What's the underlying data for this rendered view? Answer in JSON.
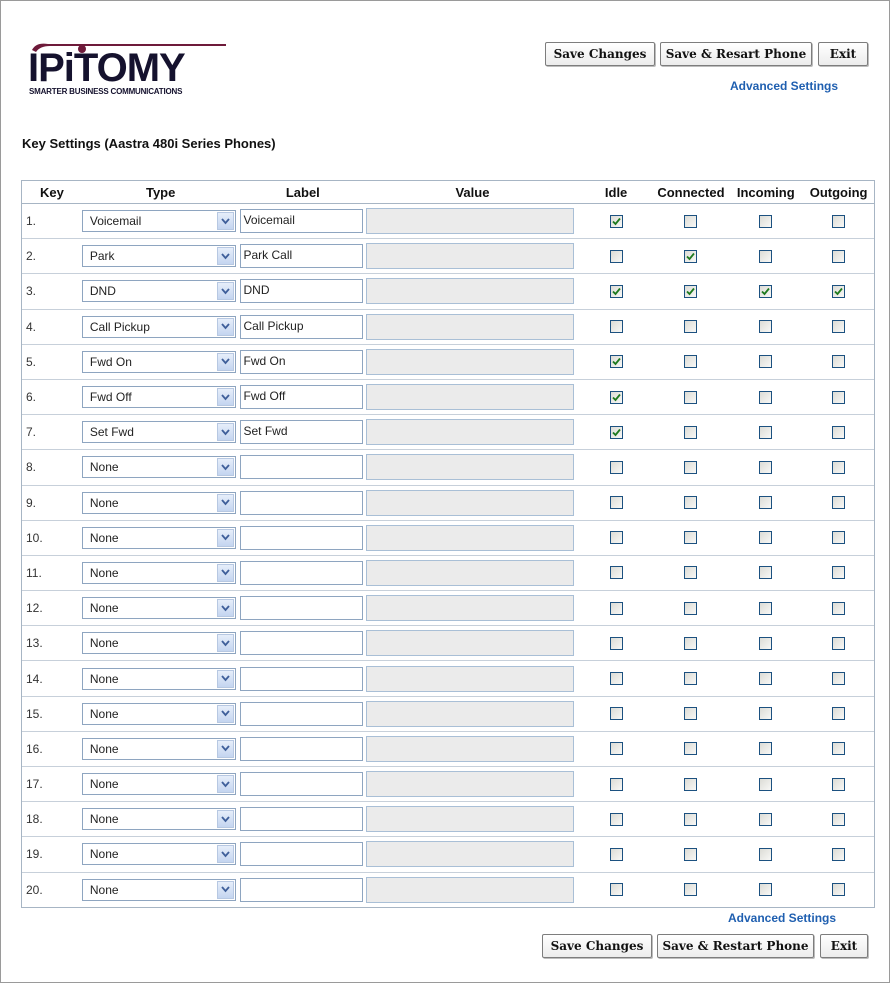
{
  "logo": {
    "word": "IPiTOMY",
    "tagline": "SMARTER BUSINESS COMMUNICATIONS",
    "brand_color": "#15122e",
    "accent_color": "#6e1a3a"
  },
  "toolbar_top": {
    "save_changes": "Save Changes",
    "save_restart": "Save & Resart Phone",
    "exit": "Exit",
    "advanced_settings": "Advanced Settings"
  },
  "toolbar_bottom": {
    "save_changes": "Save Changes",
    "save_restart": "Save & Restart Phone",
    "exit": "Exit",
    "advanced_settings": "Advanced Settings"
  },
  "page_title": "Key Settings (Aastra 480i Series Phones)",
  "table": {
    "headers": [
      "Key",
      "Type",
      "Label",
      "Value",
      "Idle",
      "Connected",
      "Incoming",
      "Outgoing"
    ],
    "rows": [
      {
        "key": "1.",
        "type": "Voicemail",
        "label": "Voicemail",
        "value": "",
        "idle": true,
        "connected": false,
        "incoming": false,
        "outgoing": false
      },
      {
        "key": "2.",
        "type": "Park",
        "label": "Park Call",
        "value": "",
        "idle": false,
        "connected": true,
        "incoming": false,
        "outgoing": false
      },
      {
        "key": "3.",
        "type": "DND",
        "label": "DND",
        "value": "",
        "idle": true,
        "connected": true,
        "incoming": true,
        "outgoing": true
      },
      {
        "key": "4.",
        "type": "Call Pickup",
        "label": "Call Pickup",
        "value": "",
        "idle": false,
        "connected": false,
        "incoming": false,
        "outgoing": false
      },
      {
        "key": "5.",
        "type": "Fwd On",
        "label": "Fwd On",
        "value": "",
        "idle": true,
        "connected": false,
        "incoming": false,
        "outgoing": false
      },
      {
        "key": "6.",
        "type": "Fwd Off",
        "label": "Fwd Off",
        "value": "",
        "idle": true,
        "connected": false,
        "incoming": false,
        "outgoing": false
      },
      {
        "key": "7.",
        "type": "Set Fwd",
        "label": "Set Fwd",
        "value": "",
        "idle": true,
        "connected": false,
        "incoming": false,
        "outgoing": false
      },
      {
        "key": "8.",
        "type": "None",
        "label": "",
        "value": "",
        "idle": false,
        "connected": false,
        "incoming": false,
        "outgoing": false
      },
      {
        "key": "9.",
        "type": "None",
        "label": "",
        "value": "",
        "idle": false,
        "connected": false,
        "incoming": false,
        "outgoing": false
      },
      {
        "key": "10.",
        "type": "None",
        "label": "",
        "value": "",
        "idle": false,
        "connected": false,
        "incoming": false,
        "outgoing": false
      },
      {
        "key": "11.",
        "type": "None",
        "label": "",
        "value": "",
        "idle": false,
        "connected": false,
        "incoming": false,
        "outgoing": false
      },
      {
        "key": "12.",
        "type": "None",
        "label": "",
        "value": "",
        "idle": false,
        "connected": false,
        "incoming": false,
        "outgoing": false
      },
      {
        "key": "13.",
        "type": "None",
        "label": "",
        "value": "",
        "idle": false,
        "connected": false,
        "incoming": false,
        "outgoing": false
      },
      {
        "key": "14.",
        "type": "None",
        "label": "",
        "value": "",
        "idle": false,
        "connected": false,
        "incoming": false,
        "outgoing": false
      },
      {
        "key": "15.",
        "type": "None",
        "label": "",
        "value": "",
        "idle": false,
        "connected": false,
        "incoming": false,
        "outgoing": false
      },
      {
        "key": "16.",
        "type": "None",
        "label": "",
        "value": "",
        "idle": false,
        "connected": false,
        "incoming": false,
        "outgoing": false
      },
      {
        "key": "17.",
        "type": "None",
        "label": "",
        "value": "",
        "idle": false,
        "connected": false,
        "incoming": false,
        "outgoing": false
      },
      {
        "key": "18.",
        "type": "None",
        "label": "",
        "value": "",
        "idle": false,
        "connected": false,
        "incoming": false,
        "outgoing": false
      },
      {
        "key": "19.",
        "type": "None",
        "label": "",
        "value": "",
        "idle": false,
        "connected": false,
        "incoming": false,
        "outgoing": false
      },
      {
        "key": "20.",
        "type": "None",
        "label": "",
        "value": "",
        "idle": false,
        "connected": false,
        "incoming": false,
        "outgoing": false
      }
    ]
  },
  "colors": {
    "link": "#1f5fb0",
    "grid_border": "#a7b5c4",
    "checkmark": "#1e7a1e"
  },
  "icons": {
    "select_arrow": "chevron-down-icon",
    "checkbox_checked": "checkmark-icon"
  }
}
